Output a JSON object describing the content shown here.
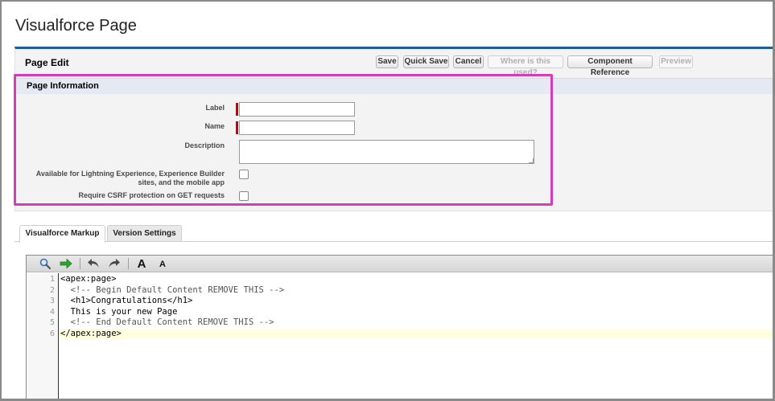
{
  "page_title": "Visualforce Page",
  "page_edit": {
    "title": "Page Edit",
    "buttons": [
      {
        "label": "Save",
        "enabled": true
      },
      {
        "label": "Quick Save",
        "enabled": true
      },
      {
        "label": "Cancel",
        "enabled": true
      },
      {
        "label": "Where is this used?",
        "enabled": false
      },
      {
        "label": "Component Reference",
        "enabled": true
      },
      {
        "label": "Preview",
        "enabled": false
      }
    ]
  },
  "page_information": {
    "title": "Page Information",
    "fields": {
      "label": {
        "label": "Label",
        "value": "",
        "required": true
      },
      "name": {
        "label": "Name",
        "value": "",
        "required": true
      },
      "description": {
        "label": "Description",
        "value": ""
      },
      "available_lightning": {
        "label_line1": "Available for Lightning Experience, Experience Builder",
        "label_line2": "sites, and the mobile app",
        "checked": false
      },
      "csrf": {
        "label": "Require CSRF protection on GET requests",
        "checked": false
      }
    }
  },
  "tabs": [
    {
      "label": "Visualforce Markup",
      "active": true
    },
    {
      "label": "Version Settings",
      "active": false
    }
  ],
  "toolbar_icons": [
    "search-icon",
    "go-to-line-arrow-icon",
    "undo-icon",
    "redo-icon",
    "increase-font-icon",
    "decrease-font-icon"
  ],
  "toolbar_glyphs": {
    "increase_font": "A",
    "decrease_font": "A"
  },
  "editor": {
    "lines": [
      {
        "num": "1",
        "text": "<apex:page>"
      },
      {
        "num": "2",
        "text": "  <!-- Begin Default Content REMOVE THIS -->"
      },
      {
        "num": "3",
        "text": "  <h1>Congratulations</h1>"
      },
      {
        "num": "4",
        "text": "  This is your new Page"
      },
      {
        "num": "5",
        "text": "  <!-- End Default Content REMOVE THIS -->"
      },
      {
        "num": "6",
        "text": "</apex:page>"
      }
    ],
    "active_line": 6
  },
  "colors": {
    "panel_accent": "#1f5a9b",
    "highlight": "#d63bb8",
    "required": "#cc0000",
    "active_line": "#ffffe0"
  }
}
